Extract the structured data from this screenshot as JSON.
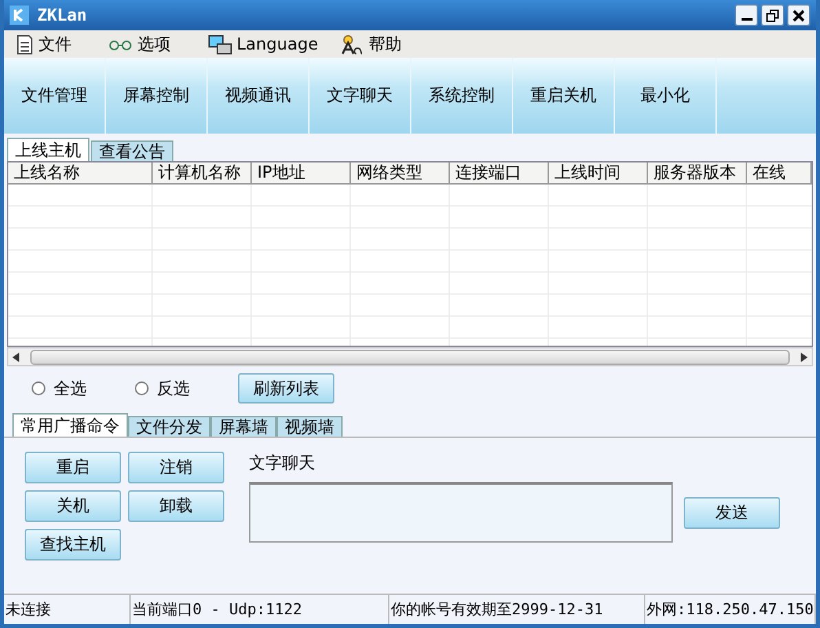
{
  "window": {
    "title": "ZKLan"
  },
  "menu": [
    {
      "label": "文件"
    },
    {
      "label": "选项"
    },
    {
      "label": "Language"
    },
    {
      "label": "帮助"
    }
  ],
  "toolbar": [
    "文件管理",
    "屏幕控制",
    "视频通讯",
    "文字聊天",
    "系统控制",
    "重启关机",
    "最小化"
  ],
  "tabs": [
    {
      "label": "上线主机",
      "selected": true
    },
    {
      "label": "查看公告",
      "selected": false
    }
  ],
  "table": {
    "columns": [
      "上线名称",
      "计算机名称",
      "IP地址",
      "网络类型",
      "连接端口",
      "上线时间",
      "服务器版本",
      "在线"
    ]
  },
  "radios": [
    {
      "label": "全选",
      "selected": false
    },
    {
      "label": "反选",
      "selected": false
    }
  ],
  "refresh_button": "刷新列表",
  "bottom_tabs": [
    {
      "label": "常用广播命令",
      "selected": true
    },
    {
      "label": "文件分发",
      "selected": false
    },
    {
      "label": "屏幕墙",
      "selected": false
    },
    {
      "label": "视频墙",
      "selected": false
    }
  ],
  "commands": [
    "重启",
    "注销",
    "关机",
    "卸载",
    "查找主机"
  ],
  "chat": {
    "label": "文字聊天",
    "send": "发送"
  },
  "status_bar": [
    "未连接",
    "当前端口0 - Udp:1122",
    "你的帐号有效期至2999-12-31",
    "外网:118.250.47.150"
  ]
}
